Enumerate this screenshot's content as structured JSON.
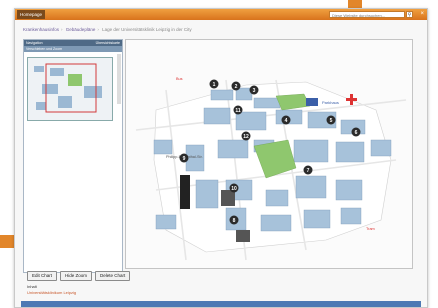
{
  "topbar": {
    "home_label": "Homepage",
    "search_placeholder": "Diese Website durchsuchen..."
  },
  "breadcrumb": {
    "items": [
      "Krankenhausinfos",
      "Gebäudepläne",
      "Lage der Universitätsklinik Leipzig in der City"
    ]
  },
  "panel": {
    "title": "Navigation",
    "title_right": "Übersichtskarte",
    "subtitle": "Verschieben und Zoom"
  },
  "map": {
    "markers": [
      "1",
      "2",
      "3",
      "4",
      "5",
      "6",
      "7",
      "8",
      "9",
      "10",
      "11",
      "12"
    ],
    "colors": {
      "buildings": "#a7c2da",
      "roads": "#f4f4f4",
      "green": "#8fc76e",
      "background": "#ffffff",
      "marker": "#2b2b2b"
    }
  },
  "buttons": {
    "edit_label": "Edit Chart",
    "hide_zoom_label": "Hide Zoom",
    "delete_label": "Delete Chart"
  },
  "info": {
    "label": "Inhalt",
    "value": "Universitätsklinikum Leipzig"
  },
  "colors": {
    "accent": "#e2862a",
    "topbar": "#d8731c",
    "link": "#6b5b9a",
    "table_header": "#4c79b4"
  }
}
